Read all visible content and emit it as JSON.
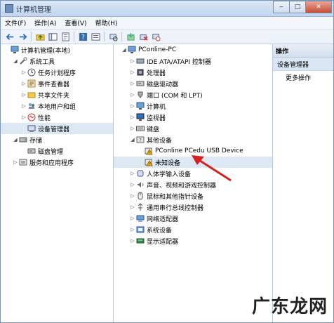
{
  "window": {
    "title": "计算机管理"
  },
  "menu": [
    "文件(F)",
    "操作(A)",
    "查看(V)",
    "帮助(H)"
  ],
  "left_tree": [
    {
      "label": "计算机管理(本地)",
      "indent": 0,
      "arrow": "",
      "icon": "computer-icon"
    },
    {
      "label": "系统工具",
      "indent": 1,
      "arrow": "◢",
      "icon": "tools-icon"
    },
    {
      "label": "任务计划程序",
      "indent": 2,
      "arrow": "▷",
      "icon": "clock-icon"
    },
    {
      "label": "事件查看器",
      "indent": 2,
      "arrow": "▷",
      "icon": "event-icon"
    },
    {
      "label": "共享文件夹",
      "indent": 2,
      "arrow": "▷",
      "icon": "folder-icon"
    },
    {
      "label": "本地用户和组",
      "indent": 2,
      "arrow": "▷",
      "icon": "users-icon"
    },
    {
      "label": "性能",
      "indent": 2,
      "arrow": "▷",
      "icon": "perf-icon"
    },
    {
      "label": "设备管理器",
      "indent": 2,
      "arrow": "",
      "icon": "device-manager-icon",
      "selected": true
    },
    {
      "label": "存储",
      "indent": 1,
      "arrow": "◢",
      "icon": "storage-icon"
    },
    {
      "label": "磁盘管理",
      "indent": 2,
      "arrow": "",
      "icon": "disk-icon"
    },
    {
      "label": "服务和应用程序",
      "indent": 1,
      "arrow": "▷",
      "icon": "services-icon"
    }
  ],
  "device_tree": [
    {
      "label": "PConline-PC",
      "indent": 0,
      "arrow": "◢",
      "icon": "computer-icon"
    },
    {
      "label": "IDE ATA/ATAPI 控制器",
      "indent": 1,
      "arrow": "▷",
      "icon": "ide-icon"
    },
    {
      "label": "处理器",
      "indent": 1,
      "arrow": "▷",
      "icon": "cpu-icon"
    },
    {
      "label": "磁盘驱动器",
      "indent": 1,
      "arrow": "▷",
      "icon": "disk-icon"
    },
    {
      "label": "端口 (COM 和 LPT)",
      "indent": 1,
      "arrow": "▷",
      "icon": "port-icon"
    },
    {
      "label": "计算机",
      "indent": 1,
      "arrow": "▷",
      "icon": "computer-icon"
    },
    {
      "label": "监视器",
      "indent": 1,
      "arrow": "▷",
      "icon": "monitor-icon"
    },
    {
      "label": "键盘",
      "indent": 1,
      "arrow": "▷",
      "icon": "keyboard-icon"
    },
    {
      "label": "其他设备",
      "indent": 1,
      "arrow": "◢",
      "icon": "other-device-icon"
    },
    {
      "label": "PConline PCedu USB Device",
      "indent": 2,
      "arrow": "",
      "icon": "warning-device-icon"
    },
    {
      "label": "未知设备",
      "indent": 2,
      "arrow": "",
      "icon": "warning-device-icon",
      "selected": true
    },
    {
      "label": "人体学输入设备",
      "indent": 1,
      "arrow": "▷",
      "icon": "hid-icon"
    },
    {
      "label": "声音、视频和游戏控制器",
      "indent": 1,
      "arrow": "▷",
      "icon": "sound-icon"
    },
    {
      "label": "鼠标和其他指针设备",
      "indent": 1,
      "arrow": "▷",
      "icon": "mouse-icon"
    },
    {
      "label": "通用串行总线控制器",
      "indent": 1,
      "arrow": "▷",
      "icon": "usb-icon"
    },
    {
      "label": "网络适配器",
      "indent": 1,
      "arrow": "▷",
      "icon": "network-icon"
    },
    {
      "label": "系统设备",
      "indent": 1,
      "arrow": "▷",
      "icon": "system-icon"
    },
    {
      "label": "显示适配器",
      "indent": 1,
      "arrow": "▷",
      "icon": "display-icon"
    }
  ],
  "actions": {
    "header": "操作",
    "selected": "设备管理器",
    "more": "更多操作"
  },
  "watermark": "广东龙网",
  "colors": {
    "accent": "#3a6ea5",
    "warning": "#f0b400",
    "annotation": "#d61f1f"
  }
}
